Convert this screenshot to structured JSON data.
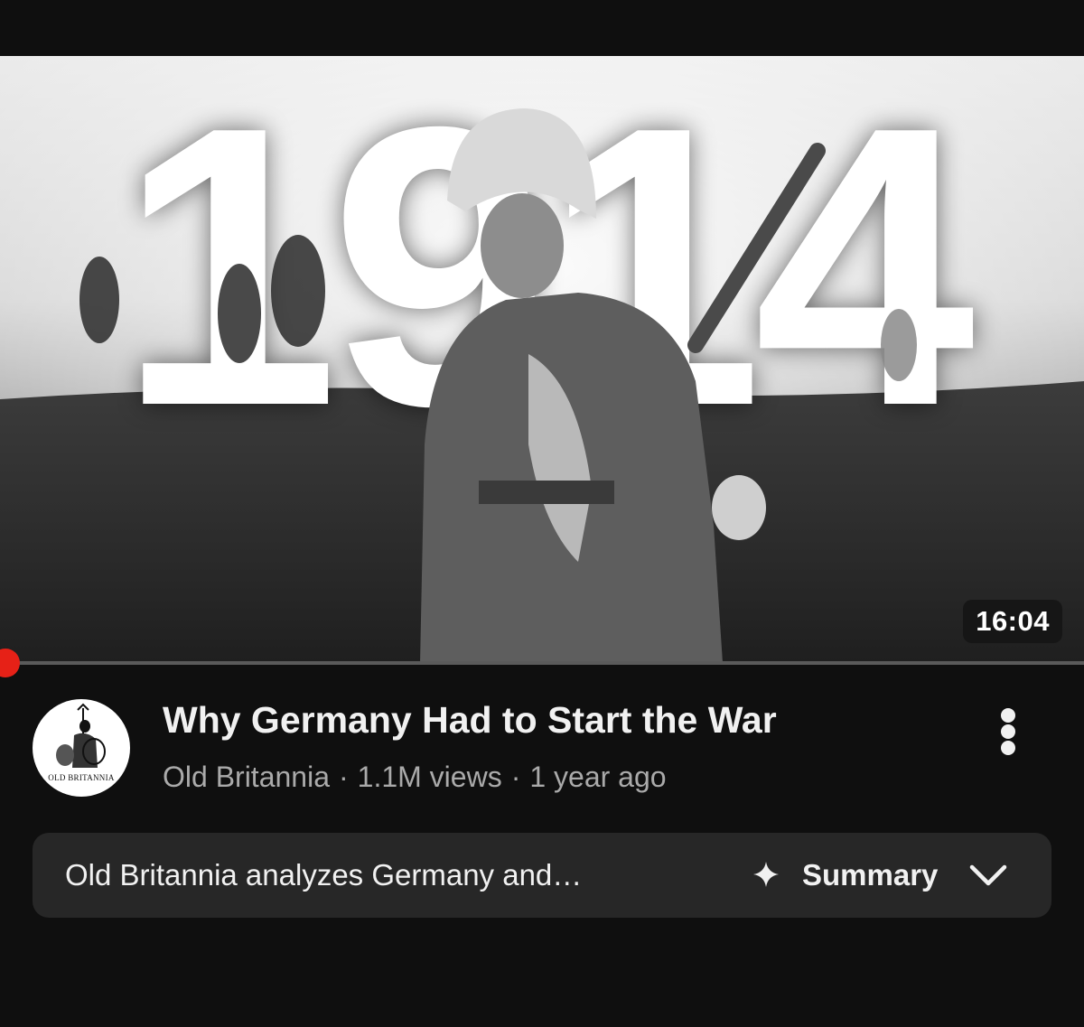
{
  "thumbnail": {
    "overlay_text": "1914",
    "duration": "16:04",
    "watch_progress_percent": 0.5
  },
  "channel": {
    "avatar_text": "OLD BRITANNIA"
  },
  "video": {
    "title": "Why Germany Had to Start the War",
    "channel_name": "Old Britannia",
    "separator": "·",
    "views": "1.1M views",
    "age": "1 year ago"
  },
  "summary": {
    "text": "Old Britannia analyzes Germany and…",
    "button_label": "Summary",
    "icon": "sparkle-icon",
    "expand_icon": "chevron-down-icon"
  },
  "colors": {
    "background": "#0f0f0f",
    "progress": "#e62117",
    "summary_bg": "#272727",
    "meta_text": "#aaaaaa"
  }
}
